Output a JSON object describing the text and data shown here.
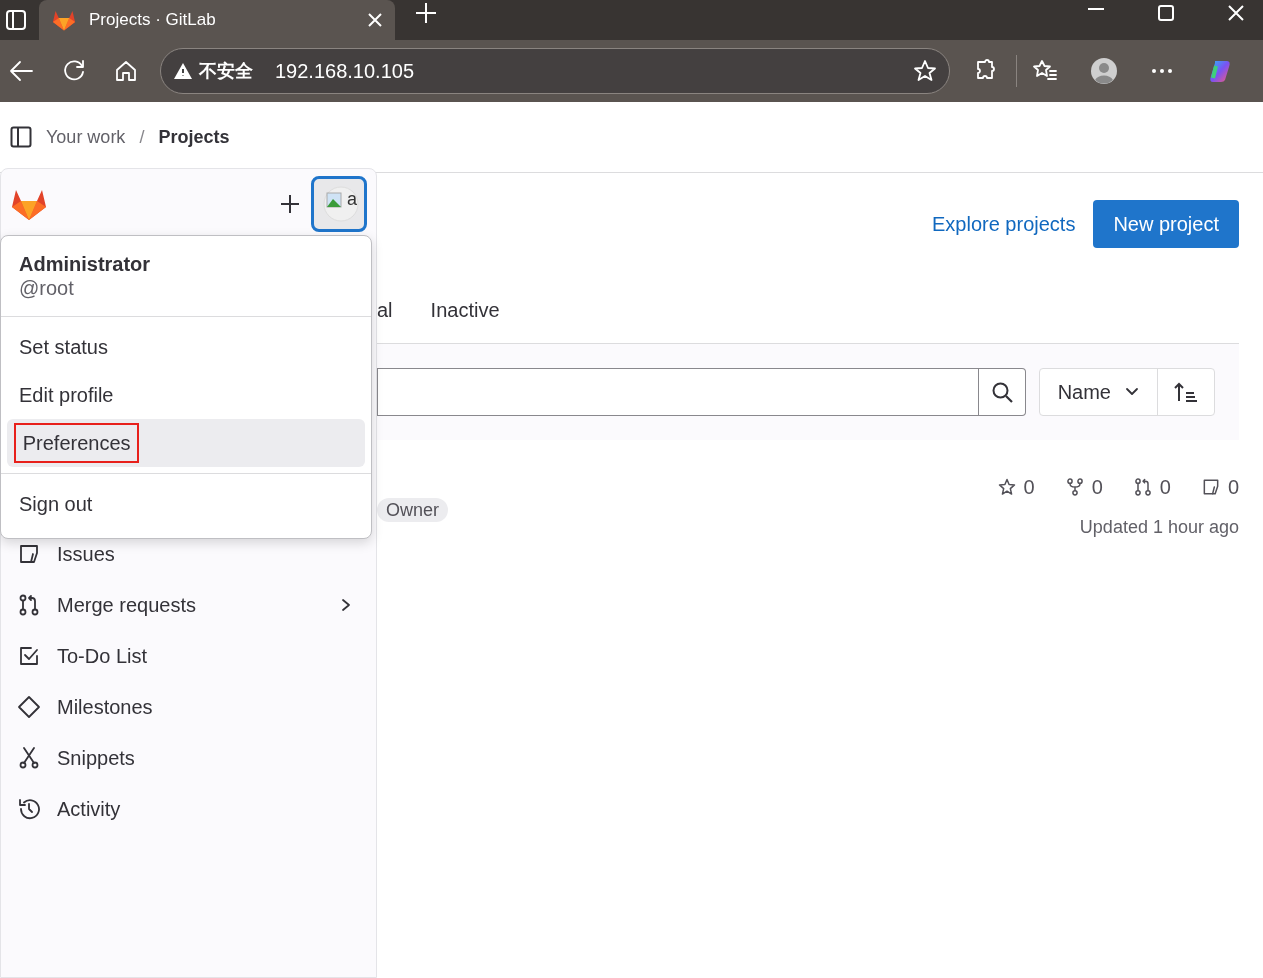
{
  "browser": {
    "tab_title": "Projects · GitLab",
    "security_label": "不安全",
    "url": "192.168.10.105"
  },
  "breadcrumb_separator": "/",
  "breadcrumb": [
    {
      "label": "Your work",
      "current": false
    },
    {
      "label": "Projects",
      "current": true
    }
  ],
  "user_menu": {
    "avatar_alt": "a",
    "name": "Administrator",
    "username": "@root",
    "open": true,
    "items": [
      {
        "label": "Set status",
        "highlighted": false,
        "marked": false
      },
      {
        "label": "Edit profile",
        "highlighted": false,
        "marked": false
      },
      {
        "label": "Preferences",
        "highlighted": true,
        "marked": true
      }
    ],
    "footer_items": [
      {
        "label": "Sign out",
        "highlighted": false,
        "marked": false
      }
    ]
  },
  "sidebar": {
    "items": [
      {
        "label": "Issues",
        "kind": "issues",
        "has_submenu": false
      },
      {
        "label": "Merge requests",
        "kind": "merge",
        "has_submenu": true
      },
      {
        "label": "To-Do List",
        "kind": "todo",
        "has_submenu": false
      },
      {
        "label": "Milestones",
        "kind": "milestone",
        "has_submenu": false
      },
      {
        "label": "Snippets",
        "kind": "snippet",
        "has_submenu": false
      },
      {
        "label": "Activity",
        "kind": "activity",
        "has_submenu": false
      }
    ]
  },
  "header_actions": {
    "link": "Explore projects",
    "button": "New project"
  },
  "tabs": [
    {
      "label": "al",
      "selected": false
    },
    {
      "label": "Inactive",
      "selected": false
    }
  ],
  "filter": {
    "sort": "Name"
  },
  "project": {
    "role": "Owner",
    "stats": [
      {
        "kind": "star",
        "count": "0"
      },
      {
        "kind": "fork",
        "count": "0"
      },
      {
        "kind": "merge",
        "count": "0"
      },
      {
        "kind": "issues",
        "count": "0"
      }
    ],
    "updated": "Updated 1 hour ago"
  }
}
